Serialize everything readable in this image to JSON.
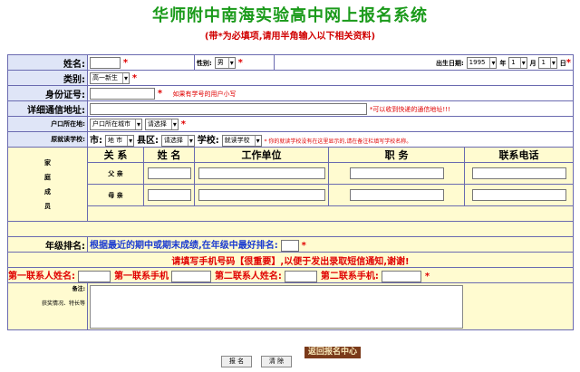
{
  "header": {
    "title": "华师附中南海实验高中网上报名系统",
    "subtitle": "(带*为必填项,请用半角输入以下相关资料)"
  },
  "form": {
    "star": "*",
    "name_label": "姓名:",
    "gender_label": "性别:",
    "gender_value": "男",
    "birth_label": "出生日期:",
    "birth_year": "1995",
    "year_unit": "年",
    "birth_month": "1",
    "month_unit": "月",
    "birth_day": "1",
    "day_unit": "日",
    "category_label": "类别:",
    "category_value": "高一新生",
    "id_label": "身份证号:",
    "id_note": "如果有学号的用户小写",
    "address_label": "详细通信地址:",
    "address_note": "*可以收到快递的通信地址!!!",
    "hukou_label": "户口所在地:",
    "hukou_value1": "户口所在城市",
    "hukou_value2": "请选择",
    "school_label": "原就读学校:",
    "city_label": "市:",
    "city_value": "地 市",
    "district_label": "县区:",
    "district_value": "请选择",
    "school_sel_label": "学校:",
    "school_value": "就读学校",
    "school_note": "* 你的就读学校没有在这里显示的,请在备注栏填写学校名称。",
    "family_side": [
      "家",
      "庭",
      "成",
      "员"
    ],
    "family_headers": [
      "关 系",
      "姓 名",
      "工作单位",
      "职 务",
      "联系电话"
    ],
    "family_rows": [
      "父 亲",
      "母 亲"
    ],
    "rank_label": "年级排名:",
    "rank_text": "根据最近的期中或期末成绩,在年级中最好排名:",
    "phone_note": "请填写手机号码【很重要】,以便于发出录取短信通知,谢谢!",
    "contact1_name": "第一联系人姓名:",
    "contact1_phone": "第一联系手机",
    "contact2_name": "第二联系人姓名:",
    "contact2_phone": "第二联系手机:",
    "remark_label": "备注:",
    "remark_sub": "获奖情况、特长等"
  },
  "buttons": {
    "submit": "报 名",
    "clear": "清 除",
    "back": "返回报名中心"
  }
}
